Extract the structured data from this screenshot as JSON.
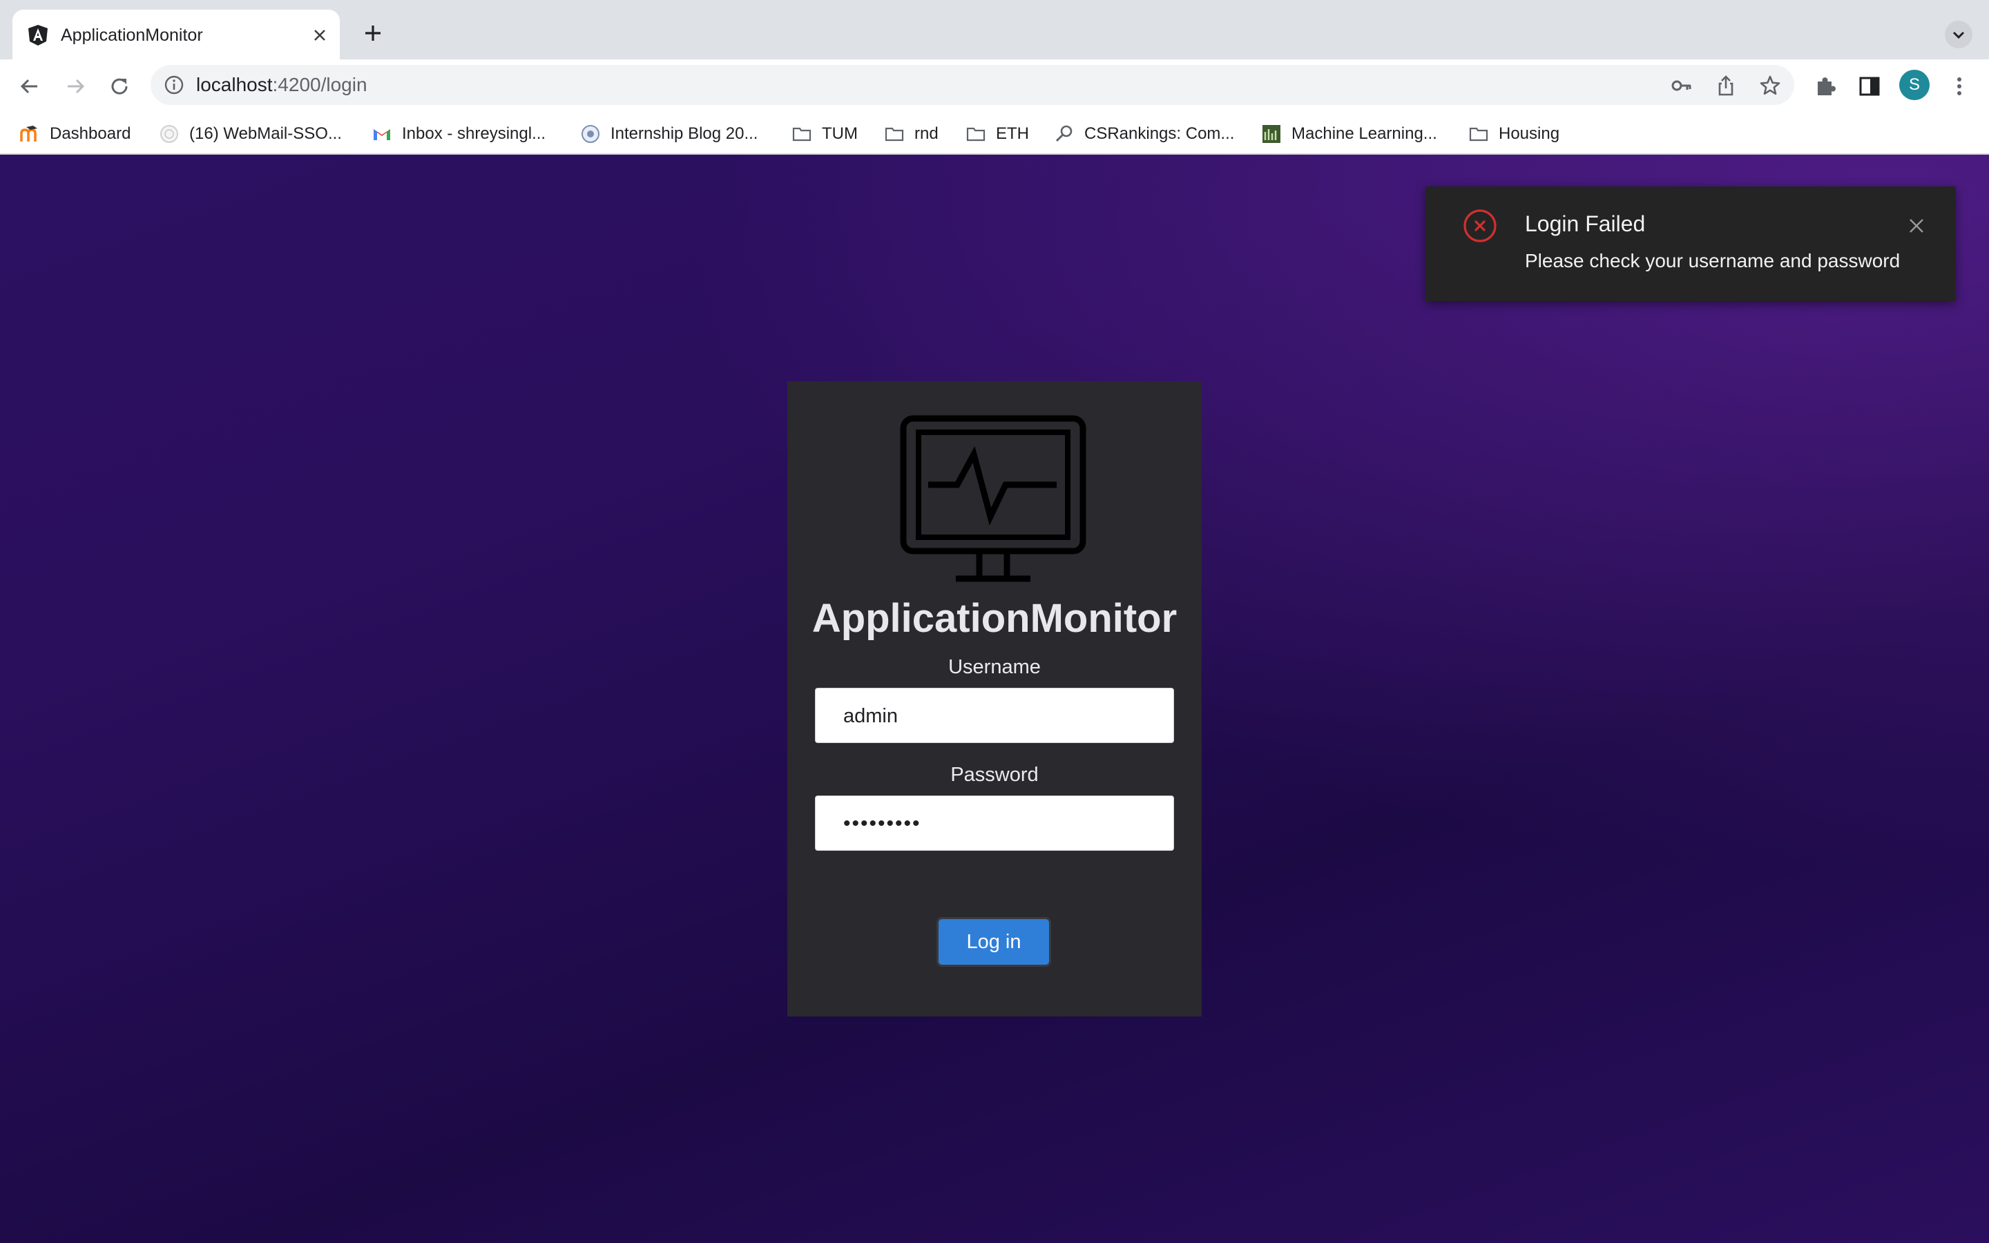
{
  "browser": {
    "tab_title": "ApplicationMonitor",
    "url_host": "localhost",
    "url_path": ":4200/login",
    "avatar_letter": "S",
    "bookmarks": [
      {
        "label": "Dashboard",
        "icon": "moodle-icon"
      },
      {
        "label": "(16) WebMail-SSO...",
        "icon": "webmail-icon"
      },
      {
        "label": "Inbox - shreysingl...",
        "icon": "gmail-icon"
      },
      {
        "label": "Internship Blog 20...",
        "icon": "blog-icon"
      },
      {
        "label": "TUM",
        "icon": "folder-icon"
      },
      {
        "label": "rnd",
        "icon": "folder-icon"
      },
      {
        "label": "ETH",
        "icon": "folder-icon"
      },
      {
        "label": "CSRankings: Com...",
        "icon": "magnifier-icon"
      },
      {
        "label": "Machine Learning...",
        "icon": "ml-icon"
      },
      {
        "label": "Housing",
        "icon": "folder-icon"
      }
    ]
  },
  "login": {
    "app_name": "ApplicationMonitor",
    "username_label": "Username",
    "username_value": "admin",
    "password_label": "Password",
    "password_value": "•••••••••",
    "submit_label": "Log in"
  },
  "toast": {
    "title": "Login Failed",
    "message": "Please check your username and password"
  },
  "colors": {
    "page_bg": "#2a0f5c",
    "card_bg": "#2a292e",
    "button": "#2f7fd8",
    "toast_bg": "#242424",
    "error": "#d32f2f"
  }
}
